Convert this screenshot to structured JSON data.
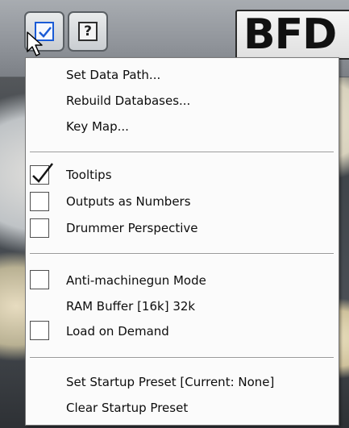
{
  "toolbar": {
    "checkbox_button_icon": "checkbox-icon",
    "help_button_label": "?",
    "logo_text": "BFD"
  },
  "menu": {
    "group1": [
      "Set Data Path...",
      "Rebuild Databases...",
      "Key Map..."
    ],
    "group2": [
      {
        "label": "Tooltips",
        "checked": true
      },
      {
        "label": "Outputs as Numbers",
        "checked": false
      },
      {
        "label": "Drummer Perspective",
        "checked": false
      }
    ],
    "group3": [
      {
        "label": "Anti-machinegun Mode",
        "checked": false
      },
      {
        "label": "RAM Buffer [16k] 32k"
      },
      {
        "label": "Load on Demand",
        "checked": false
      }
    ],
    "group4": [
      "Set Startup Preset [Current: None]",
      "Clear Startup Preset"
    ]
  },
  "colors": {
    "menu_background": "#fbfbfb",
    "checkbox_accent": "#1a5bd6",
    "separator": "#9a9a9a"
  }
}
